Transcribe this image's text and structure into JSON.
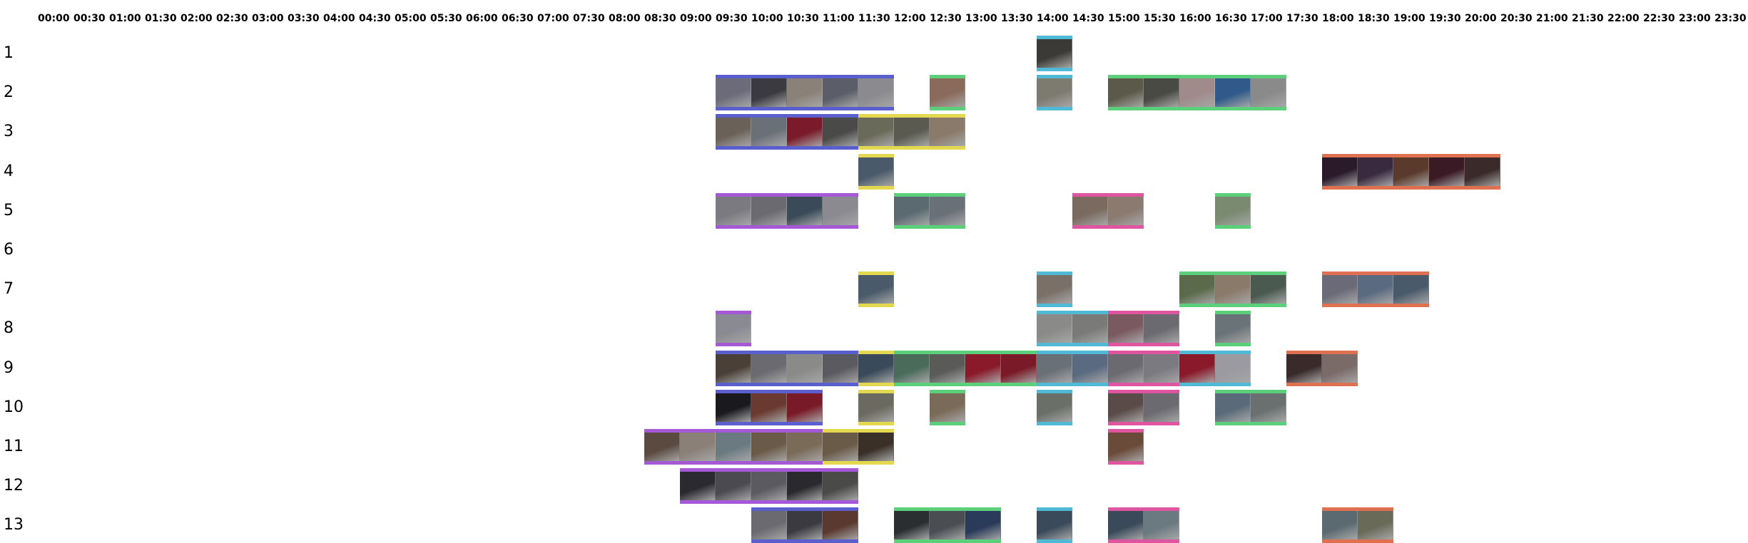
{
  "timeline": {
    "time_labels": [
      "00:00",
      "00:30",
      "01:00",
      "01:30",
      "02:00",
      "02:30",
      "03:00",
      "03:30",
      "04:00",
      "04:30",
      "05:00",
      "05:30",
      "06:00",
      "06:30",
      "07:00",
      "07:30",
      "08:00",
      "08:30",
      "09:00",
      "09:30",
      "10:00",
      "10:30",
      "11:00",
      "11:30",
      "12:00",
      "12:30",
      "13:00",
      "13:30",
      "14:00",
      "14:30",
      "15:00",
      "15:30",
      "16:00",
      "16:30",
      "17:00",
      "17:30",
      "18:00",
      "18:30",
      "19:00",
      "19:30",
      "20:00",
      "20:30",
      "21:00",
      "21:30",
      "22:00",
      "22:30",
      "23:00",
      "23:30"
    ],
    "row_labels": [
      "1",
      "2",
      "3",
      "4",
      "5",
      "6",
      "7",
      "8",
      "9",
      "10",
      "11",
      "12",
      "13"
    ],
    "colors": {
      "blue": "#5b5fce",
      "green": "#5ccf7a",
      "cyan": "#4fb9d6",
      "yellow": "#e3d84f",
      "purple": "#a559d6",
      "pink": "#e0559f",
      "orange": "#e07150"
    },
    "segments": [
      {
        "row": 0,
        "start": "14:00",
        "end": "14:30",
        "color": "cyan",
        "thumbs": [
          "#3c3a36"
        ]
      },
      {
        "row": 1,
        "start": "09:30",
        "end": "12:00",
        "color": "blue",
        "thumbs": [
          "#6b6b7a",
          "#3a3a40",
          "#8a8178",
          "#5b5e68",
          "#8a8a8f"
        ]
      },
      {
        "row": 1,
        "start": "12:30",
        "end": "13:00",
        "color": "green",
        "thumbs": [
          "#8a6a5a"
        ]
      },
      {
        "row": 1,
        "start": "14:00",
        "end": "14:30",
        "color": "cyan",
        "thumbs": [
          "#7d7a70"
        ]
      },
      {
        "row": 1,
        "start": "15:00",
        "end": "17:30",
        "color": "green",
        "thumbs": [
          "#5b5a4a",
          "#4a4a44",
          "#a08a8a",
          "#2f5a8a",
          "#8a8a8a"
        ]
      },
      {
        "row": 2,
        "start": "09:30",
        "end": "11:30",
        "color": "blue",
        "thumbs": [
          "#6a6258",
          "#6a7078",
          "#7a1a2a",
          "#4a4a48"
        ]
      },
      {
        "row": 2,
        "start": "11:30",
        "end": "13:00",
        "color": "yellow",
        "thumbs": [
          "#6a6a5a",
          "#5a5a50",
          "#8a7a6a"
        ]
      },
      {
        "row": 3,
        "start": "11:30",
        "end": "12:00",
        "color": "yellow",
        "thumbs": [
          "#4a5a6a"
        ]
      },
      {
        "row": 3,
        "start": "18:00",
        "end": "20:30",
        "color": "orange",
        "thumbs": [
          "#2a1a2a",
          "#3a2a40",
          "#5a3a2a",
          "#3a1a24",
          "#3a2a2a"
        ]
      },
      {
        "row": 4,
        "start": "09:30",
        "end": "11:30",
        "color": "purple",
        "thumbs": [
          "#7a7a80",
          "#6a6a70",
          "#3a4a58",
          "#8a8a90"
        ]
      },
      {
        "row": 4,
        "start": "12:00",
        "end": "13:00",
        "color": "green",
        "thumbs": [
          "#5a6a70",
          "#6a7078"
        ]
      },
      {
        "row": 4,
        "start": "14:30",
        "end": "15:30",
        "color": "pink",
        "thumbs": [
          "#7a6a60",
          "#8a7a70"
        ]
      },
      {
        "row": 4,
        "start": "16:30",
        "end": "17:00",
        "color": "green",
        "thumbs": [
          "#7a8a70"
        ]
      },
      {
        "row": 6,
        "start": "11:30",
        "end": "12:00",
        "color": "yellow",
        "thumbs": [
          "#4a5a6a"
        ]
      },
      {
        "row": 6,
        "start": "14:00",
        "end": "14:30",
        "color": "cyan",
        "thumbs": [
          "#7a7068"
        ]
      },
      {
        "row": 6,
        "start": "16:00",
        "end": "17:30",
        "color": "green",
        "thumbs": [
          "#5a6a4a",
          "#8a7a6a",
          "#4a5a50"
        ]
      },
      {
        "row": 6,
        "start": "18:00",
        "end": "19:30",
        "color": "orange",
        "thumbs": [
          "#6a6a78",
          "#5a6a80",
          "#4a5a6a"
        ]
      },
      {
        "row": 7,
        "start": "09:30",
        "end": "10:00",
        "color": "purple",
        "thumbs": [
          "#8a8a92"
        ]
      },
      {
        "row": 7,
        "start": "14:00",
        "end": "15:00",
        "color": "cyan",
        "thumbs": [
          "#8a8a88",
          "#7a7a78"
        ]
      },
      {
        "row": 7,
        "start": "15:00",
        "end": "16:00",
        "color": "pink",
        "thumbs": [
          "#7a5a60",
          "#6a6a70"
        ]
      },
      {
        "row": 7,
        "start": "16:30",
        "end": "17:00",
        "color": "green",
        "thumbs": [
          "#6a7478"
        ]
      },
      {
        "row": 8,
        "start": "09:30",
        "end": "11:30",
        "color": "blue",
        "thumbs": [
          "#4a4038",
          "#6a6a70",
          "#8a8a88",
          "#5a5a60"
        ]
      },
      {
        "row": 8,
        "start": "11:30",
        "end": "12:00",
        "color": "yellow",
        "thumbs": [
          "#3a4a5a"
        ]
      },
      {
        "row": 8,
        "start": "12:00",
        "end": "14:00",
        "color": "green",
        "thumbs": [
          "#4a6a5a",
          "#5a5a58",
          "#8a1a2a",
          "#7a1a28"
        ]
      },
      {
        "row": 8,
        "start": "14:00",
        "end": "15:00",
        "color": "cyan",
        "thumbs": [
          "#6a7078",
          "#5a6a80"
        ]
      },
      {
        "row": 8,
        "start": "15:00",
        "end": "16:00",
        "color": "pink",
        "thumbs": [
          "#6a6a70",
          "#7a7a80"
        ]
      },
      {
        "row": 8,
        "start": "16:00",
        "end": "17:00",
        "color": "cyan",
        "thumbs": [
          "#8a1a2a",
          "#9a9aa0"
        ]
      },
      {
        "row": 8,
        "start": "17:30",
        "end": "18:30",
        "color": "orange",
        "thumbs": [
          "#3a2a2a",
          "#7a6a68"
        ]
      },
      {
        "row": 9,
        "start": "09:30",
        "end": "10:30",
        "color": "blue",
        "thumbs": [
          "#1a1a1e",
          "#6a3a30"
        ]
      },
      {
        "row": 9,
        "start": "10:30",
        "end": "11:00",
        "color": "blue",
        "thumbs": [
          "#7a1a28"
        ]
      },
      {
        "row": 9,
        "start": "11:30",
        "end": "12:00",
        "color": "yellow",
        "thumbs": [
          "#6a6a60"
        ]
      },
      {
        "row": 9,
        "start": "12:30",
        "end": "13:00",
        "color": "green",
        "thumbs": [
          "#7a6a58"
        ]
      },
      {
        "row": 9,
        "start": "14:00",
        "end": "14:30",
        "color": "cyan",
        "thumbs": [
          "#6a7068"
        ]
      },
      {
        "row": 9,
        "start": "15:00",
        "end": "16:00",
        "color": "pink",
        "thumbs": [
          "#5a4a48",
          "#6a6a70"
        ]
      },
      {
        "row": 9,
        "start": "16:30",
        "end": "17:30",
        "color": "green",
        "thumbs": [
          "#5a6a78",
          "#6a7070"
        ]
      },
      {
        "row": 10,
        "start": "08:30",
        "end": "11:00",
        "color": "purple",
        "thumbs": [
          "#5a4a40",
          "#8a8078",
          "#6a7a80",
          "#6a5a48",
          "#7a6a58"
        ]
      },
      {
        "row": 10,
        "start": "11:00",
        "end": "12:00",
        "color": "yellow",
        "thumbs": [
          "#6a5a48",
          "#3a3028"
        ]
      },
      {
        "row": 10,
        "start": "15:00",
        "end": "15:30",
        "color": "pink",
        "thumbs": [
          "#6a4a38"
        ]
      },
      {
        "row": 11,
        "start": "09:00",
        "end": "11:30",
        "color": "purple",
        "thumbs": [
          "#2a2a30",
          "#4a4a50",
          "#5a5a60",
          "#2a2a2e",
          "#4a4a48"
        ]
      },
      {
        "row": 12,
        "start": "10:00",
        "end": "11:30",
        "color": "blue",
        "thumbs": [
          "#6a6a70",
          "#3a3a40",
          "#5a3a30"
        ]
      },
      {
        "row": 12,
        "start": "12:00",
        "end": "13:30",
        "color": "green",
        "thumbs": [
          "#2a2e30",
          "#4a4e52",
          "#2a3a5a"
        ]
      },
      {
        "row": 12,
        "start": "14:00",
        "end": "14:30",
        "color": "cyan",
        "thumbs": [
          "#3a4a5a"
        ]
      },
      {
        "row": 12,
        "start": "15:00",
        "end": "16:00",
        "color": "pink",
        "thumbs": [
          "#3a4a5a",
          "#6a7a80"
        ]
      },
      {
        "row": 12,
        "start": "18:00",
        "end": "19:00",
        "color": "orange",
        "thumbs": [
          "#5a6a70",
          "#6a6a58"
        ]
      }
    ]
  }
}
